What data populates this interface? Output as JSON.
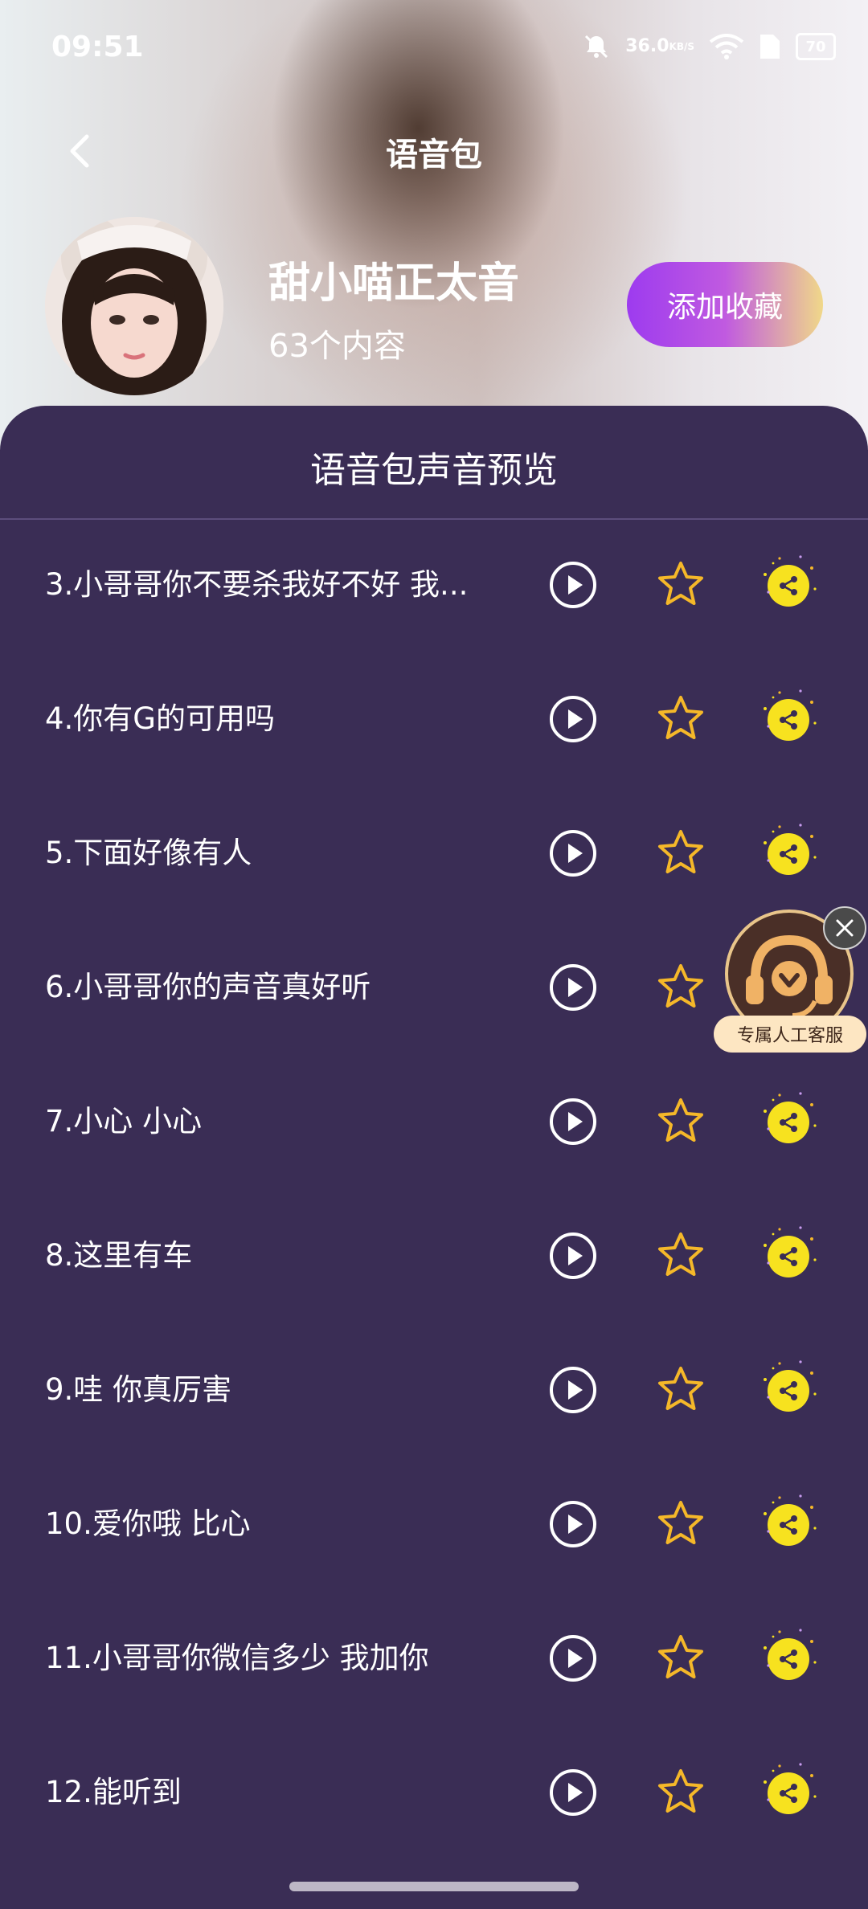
{
  "status_bar": {
    "time": "09:51",
    "net_speed": "36.0",
    "net_unit": "KB/S",
    "battery": "70"
  },
  "header": {
    "title": "语音包"
  },
  "profile": {
    "name": "甜小喵正太音",
    "count": "63个内容",
    "favorite_label": "添加收藏"
  },
  "panel": {
    "title": "语音包声音预览"
  },
  "items": [
    {
      "label": "3.小哥哥你不要杀我好不好 我..."
    },
    {
      "label": "4.你有G的可用吗"
    },
    {
      "label": "5.下面好像有人"
    },
    {
      "label": "6.小哥哥你的声音真好听"
    },
    {
      "label": "7.小心 小心"
    },
    {
      "label": "8.这里有车"
    },
    {
      "label": "9.哇 你真厉害"
    },
    {
      "label": "10.爱你哦 比心"
    },
    {
      "label": "11.小哥哥你微信多少 我加你"
    },
    {
      "label": "12.能听到"
    }
  ],
  "service": {
    "label": "专属人工客服"
  },
  "colors": {
    "panel_bg": "#3a2d55",
    "star": "#f5b829",
    "share_bg": "#f7e21f",
    "accent_purple": "#9d3bef"
  }
}
